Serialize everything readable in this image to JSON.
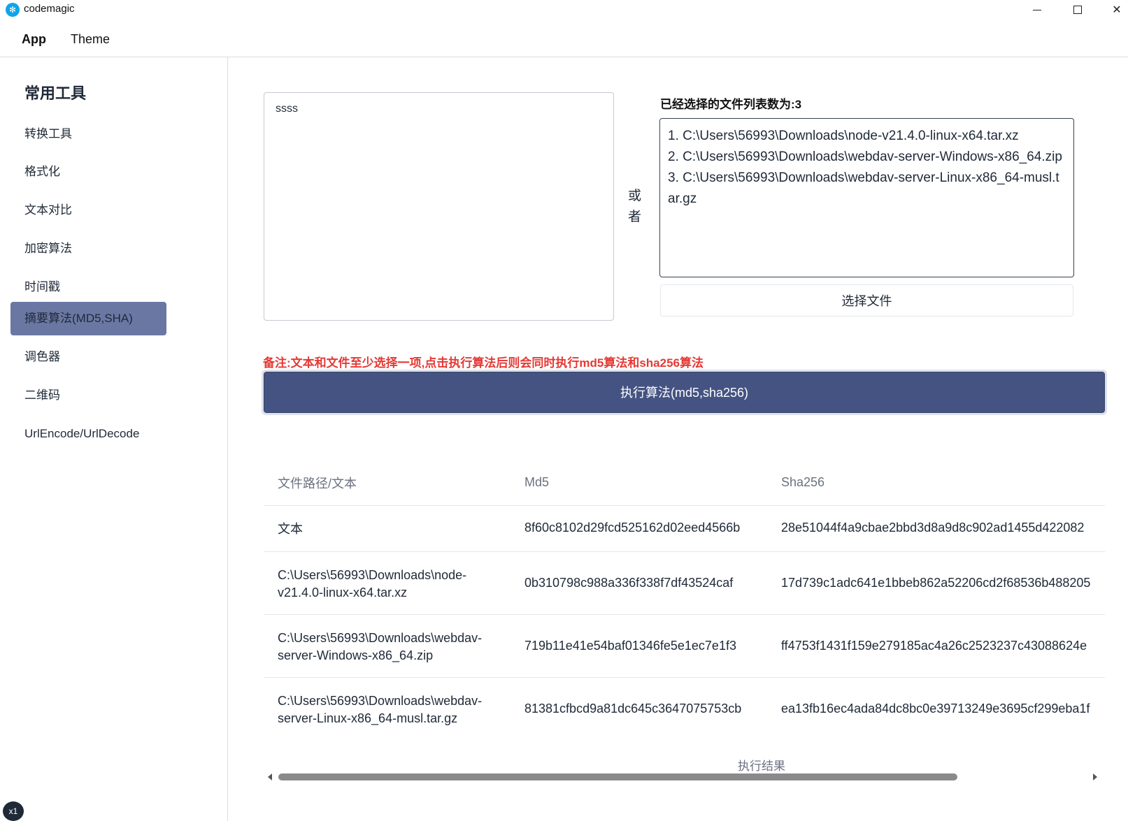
{
  "window": {
    "title": "codemagic",
    "logo_glyph": "✻",
    "minimize_icon": "minimize-icon",
    "maximize_icon": "maximize-icon",
    "close_glyph": "✕"
  },
  "menu": {
    "app": "App",
    "theme": "Theme"
  },
  "sidebar": {
    "heading": "常用工具",
    "items": [
      {
        "label": "转换工具"
      },
      {
        "label": "格式化"
      },
      {
        "label": "文本对比"
      },
      {
        "label": "加密算法"
      },
      {
        "label": "时间戳"
      },
      {
        "label": "摘要算法(MD5,SHA)",
        "active": true
      },
      {
        "label": "调色器"
      },
      {
        "label": "二维码"
      },
      {
        "label": "UrlEncode/UrlDecode"
      }
    ],
    "badge": "x1"
  },
  "main": {
    "text_input_value": "ssss",
    "or_label": "或者",
    "file_count_label": "已经选择的文件列表数为:3",
    "files": [
      "1. C:\\Users\\56993\\Downloads\\node-v21.4.0-linux-x64.tar.xz",
      "2. C:\\Users\\56993\\Downloads\\webdav-server-Windows-x86_64.zip",
      "3. C:\\Users\\56993\\Downloads\\webdav-server-Linux-x86_64-musl.tar.gz"
    ],
    "choose_file_button": "选择文件",
    "note": "备注:文本和文件至少选择一项,点击执行算法后则会同时执行md5算法和sha256算法",
    "run_button": "执行算法(md5,sha256)"
  },
  "table": {
    "headers": [
      "文件路径/文本",
      "Md5",
      "Sha256"
    ],
    "rows": [
      [
        "文本",
        "8f60c8102d29fcd525162d02eed4566b",
        "28e51044f4a9cbae2bbd3d8a9d8c902ad1455d422082"
      ],
      [
        "C:\\Users\\56993\\Downloads\\node-v21.4.0-linux-x64.tar.xz",
        "0b310798c988a336f338f7df43524caf",
        "17d739c1adc641e1bbeb862a52206cd2f68536b488205"
      ],
      [
        "C:\\Users\\56993\\Downloads\\webdav-server-Windows-x86_64.zip",
        "719b11e41e54baf01346fe5e1ec7e1f3",
        "ff4753f1431f159e279185ac4a26c2523237c43088624e"
      ],
      [
        "C:\\Users\\56993\\Downloads\\webdav-server-Linux-x86_64-musl.tar.gz",
        "81381cfbcd9a81dc645c3647075753cb",
        "ea13fb16ec4ada84dc8bc0e39713249e3695cf299eba1f"
      ]
    ],
    "caption": "执行结果"
  },
  "colors": {
    "accent": "#445382",
    "sidebar_active": "#6b77a3",
    "note": "#e53935"
  }
}
